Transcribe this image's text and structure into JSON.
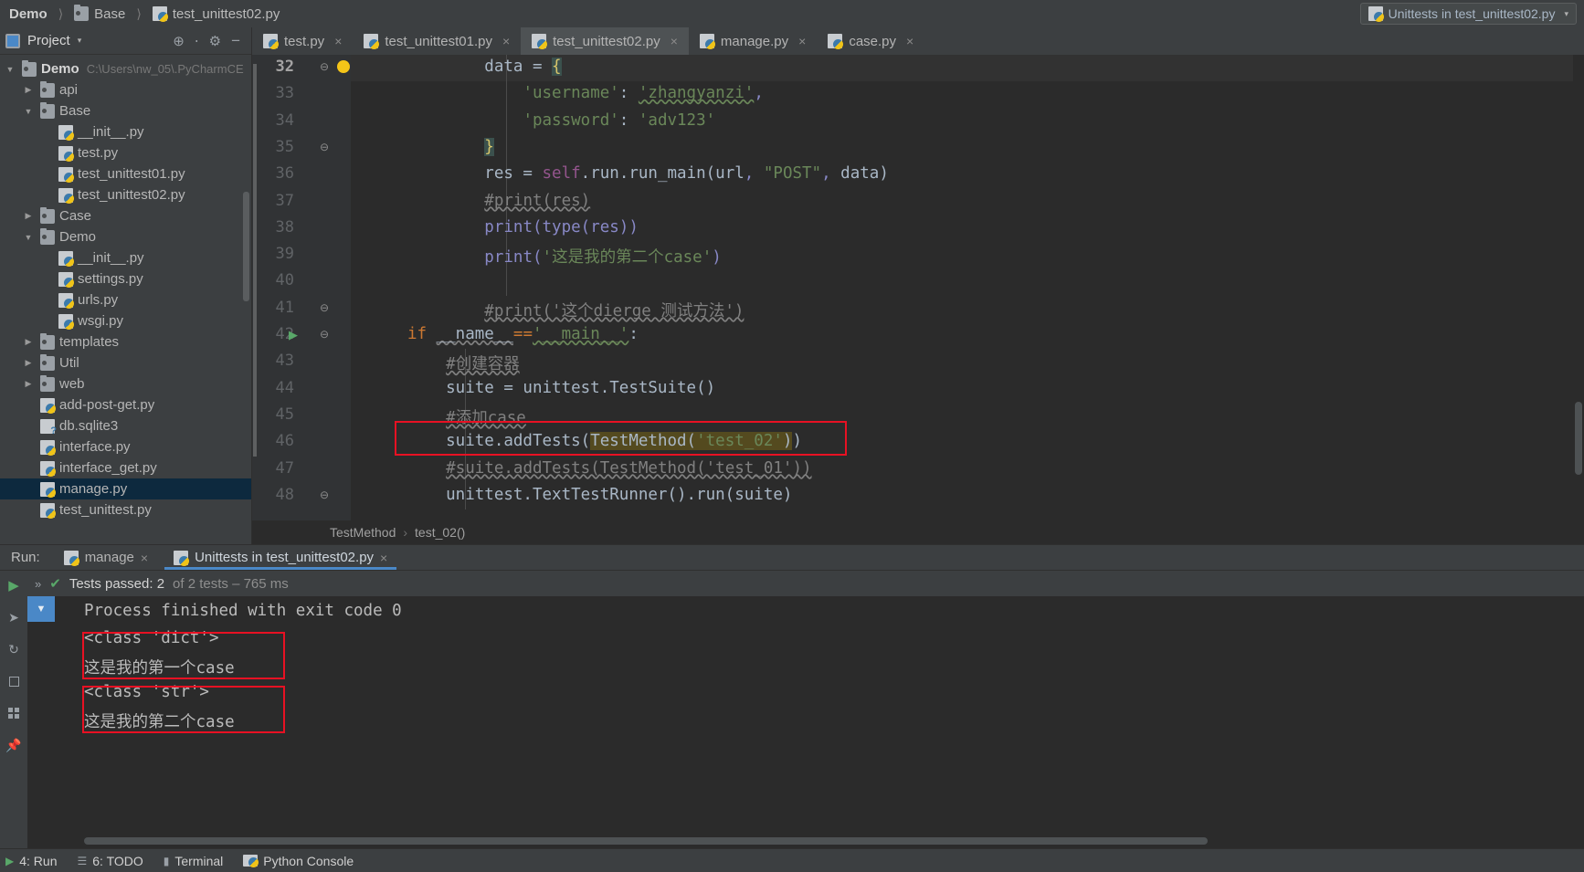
{
  "breadcrumb": {
    "items": [
      "Demo",
      "Base",
      "test_unittest02.py"
    ]
  },
  "run_config": {
    "label": "Unittests in test_unittest02.py",
    "icon": "python-test-icon",
    "caret": "▾"
  },
  "project_panel": {
    "title": "Project",
    "caret": "▾",
    "icons": [
      "locate-icon",
      "collapse-all-icon",
      "settings-icon",
      "hide-icon"
    ],
    "tree": [
      {
        "label": "Demo",
        "path": "C:\\Users\\nw_05\\.PyCharmCE",
        "arrow": "▼",
        "icon": "folder-icon",
        "indent": 0,
        "selected": false,
        "root": true
      },
      {
        "label": "api",
        "path": "",
        "arrow": "▶",
        "icon": "folder-icon",
        "indent": 1,
        "selected": false,
        "root": false
      },
      {
        "label": "Base",
        "path": "",
        "arrow": "▼",
        "icon": "folder-icon",
        "indent": 1,
        "selected": false,
        "root": false
      },
      {
        "label": "__init__.py",
        "path": "",
        "arrow": "",
        "icon": "python-file-icon",
        "indent": 2,
        "selected": false,
        "root": false
      },
      {
        "label": "test.py",
        "path": "",
        "arrow": "",
        "icon": "python-file-icon",
        "indent": 2,
        "selected": false,
        "root": false
      },
      {
        "label": "test_unittest01.py",
        "path": "",
        "arrow": "",
        "icon": "python-file-icon",
        "indent": 2,
        "selected": false,
        "root": false
      },
      {
        "label": "test_unittest02.py",
        "path": "",
        "arrow": "",
        "icon": "python-file-icon",
        "indent": 2,
        "selected": false,
        "root": false
      },
      {
        "label": "Case",
        "path": "",
        "arrow": "▶",
        "icon": "folder-icon",
        "indent": 1,
        "selected": false,
        "root": false
      },
      {
        "label": "Demo",
        "path": "",
        "arrow": "▼",
        "icon": "folder-icon",
        "indent": 1,
        "selected": false,
        "root": false
      },
      {
        "label": "__init__.py",
        "path": "",
        "arrow": "",
        "icon": "python-file-icon",
        "indent": 2,
        "selected": false,
        "root": false
      },
      {
        "label": "settings.py",
        "path": "",
        "arrow": "",
        "icon": "python-file-icon",
        "indent": 2,
        "selected": false,
        "root": false
      },
      {
        "label": "urls.py",
        "path": "",
        "arrow": "",
        "icon": "python-file-icon",
        "indent": 2,
        "selected": false,
        "root": false
      },
      {
        "label": "wsgi.py",
        "path": "",
        "arrow": "",
        "icon": "python-file-icon",
        "indent": 2,
        "selected": false,
        "root": false
      },
      {
        "label": "templates",
        "path": "",
        "arrow": "▶",
        "icon": "folder-icon",
        "indent": 1,
        "selected": false,
        "root": false
      },
      {
        "label": "Util",
        "path": "",
        "arrow": "▶",
        "icon": "folder-icon",
        "indent": 1,
        "selected": false,
        "root": false
      },
      {
        "label": "web",
        "path": "",
        "arrow": "▶",
        "icon": "folder-icon",
        "indent": 1,
        "selected": false,
        "root": false
      },
      {
        "label": "add-post-get.py",
        "path": "",
        "arrow": "",
        "icon": "python-file-icon",
        "indent": 1,
        "selected": false,
        "root": false
      },
      {
        "label": "db.sqlite3",
        "path": "",
        "arrow": "",
        "icon": "unknown-file-icon",
        "indent": 1,
        "selected": false,
        "root": false
      },
      {
        "label": "interface.py",
        "path": "",
        "arrow": "",
        "icon": "python-file-icon",
        "indent": 1,
        "selected": false,
        "root": false
      },
      {
        "label": "interface_get.py",
        "path": "",
        "arrow": "",
        "icon": "python-file-icon",
        "indent": 1,
        "selected": false,
        "root": false
      },
      {
        "label": "manage.py",
        "path": "",
        "arrow": "",
        "icon": "python-file-icon",
        "indent": 1,
        "selected": true,
        "root": false
      },
      {
        "label": "test_unittest.py",
        "path": "",
        "arrow": "",
        "icon": "python-file-icon",
        "indent": 1,
        "selected": false,
        "root": false
      }
    ]
  },
  "editor": {
    "tabs": [
      {
        "label": "test.py",
        "active": false,
        "close": "×"
      },
      {
        "label": "test_unittest01.py",
        "active": false,
        "close": "×"
      },
      {
        "label": "test_unittest02.py",
        "active": true,
        "close": "×"
      },
      {
        "label": "manage.py",
        "active": false,
        "close": "×"
      },
      {
        "label": "case.py",
        "active": false,
        "close": "×"
      }
    ],
    "lines": [
      {
        "no": "32",
        "text": "        data = {"
      },
      {
        "no": "33",
        "text": "            'username': 'zhangyanzi',"
      },
      {
        "no": "34",
        "text": "            'password': 'adv123'"
      },
      {
        "no": "35",
        "text": "        }"
      },
      {
        "no": "36",
        "text": "        res = self.run.run_main(url, \"POST\", data)"
      },
      {
        "no": "37",
        "text": "        #print(res)"
      },
      {
        "no": "38",
        "text": "        print(type(res))"
      },
      {
        "no": "39",
        "text": "        print('这是我的第二个case')"
      },
      {
        "no": "40",
        "text": ""
      },
      {
        "no": "41",
        "text": "        #print('这个dierge 测试方法')"
      },
      {
        "no": "42",
        "text": "if __name__=='__main__':"
      },
      {
        "no": "43",
        "text": "    #创建容器"
      },
      {
        "no": "44",
        "text": "    suite = unittest.TestSuite()"
      },
      {
        "no": "45",
        "text": "    #添加case"
      },
      {
        "no": "46",
        "text": "    suite.addTests(TestMethod('test_02'))"
      },
      {
        "no": "47",
        "text": "    #suite.addTests(TestMethod('test_01'))"
      },
      {
        "no": "48",
        "text": "    unittest.TextTestRunner().run(suite)"
      }
    ],
    "code_fragments": {
      "l32_data": "data = ",
      "l32_brace": "{",
      "l33_key": "'username'",
      "l33_colon": ": ",
      "l33_val": "'zhangyanzi'",
      "l33_comma": ",",
      "l34_key": "'password'",
      "l34_colon": ": ",
      "l34_val": "'adv123'",
      "l35_brace": "}",
      "l36_a": "res = ",
      "l36_self": "self",
      "l36_b": ".run.run_main(url",
      "l36_c": ", ",
      "l36_str": "\"POST\"",
      "l36_d": ", data)",
      "l37": "#print(res)",
      "l38_fn": "print",
      "l38_rest": "(type(res))",
      "l39_fn": "print",
      "l39_p1": "(",
      "l39_str": "'这是我的第二个case'",
      "l39_p2": ")",
      "l41": "#print('这个dierge 测试方法')",
      "l42_if": "if ",
      "l42_name": "__name__",
      "l42_eq": "==",
      "l42_main": "'__main__'",
      "l42_colon": ":",
      "l43": "#创建容器",
      "l44": "suite = unittest.TestSuite()",
      "l45": "#添加case",
      "l46_a": "suite.addTests(",
      "l46_b": "TestMethod(",
      "l46_str": "'test_02'",
      "l46_c": ")",
      "l46_d": ")",
      "l47": "#suite.addTests(TestMethod('test_01'))",
      "l48": "unittest.TextTestRunner().run(suite)"
    },
    "breadcrumb": {
      "class": "TestMethod",
      "sep": "›",
      "method": "test_02()"
    }
  },
  "run_panel": {
    "label": "Run:",
    "tabs": [
      {
        "label": "manage",
        "active": false,
        "close": "×",
        "icon": "python-run-icon"
      },
      {
        "label": "Unittests in test_unittest02.py",
        "active": true,
        "close": "×",
        "icon": "python-test-icon"
      }
    ],
    "toolbar_icons": [
      "rerun-icon",
      "rerun-failed-icon",
      "toggle-auto-test-icon",
      "stop-icon",
      "layout-icon",
      "pin-icon"
    ],
    "status": {
      "chevron": "»",
      "check": "✔",
      "main": "Tests passed: 2",
      "dim": " of 2 tests – 765 ms"
    },
    "console_lines": [
      {
        "text": "Process finished with exit code 0",
        "boxed": false
      },
      {
        "text": "<class 'dict'>",
        "boxed": false
      },
      {
        "text": "这是我的第一个case",
        "boxed": true
      },
      {
        "text": "<class 'str'>",
        "boxed": false
      },
      {
        "text": "这是我的第二个case",
        "boxed": true
      }
    ]
  },
  "status_bar": {
    "items": [
      {
        "label": "4: Run",
        "icon": "run-icon"
      },
      {
        "label": "6: TODO",
        "icon": "todo-icon"
      },
      {
        "label": "Terminal",
        "icon": "terminal-icon"
      },
      {
        "label": "Python Console",
        "icon": "python-console-icon"
      }
    ]
  },
  "colors": {
    "accent": "#4a88c7",
    "highlight_box": "#e81123",
    "pass_green": "#59a869",
    "selection_blue": "#0d293e"
  }
}
